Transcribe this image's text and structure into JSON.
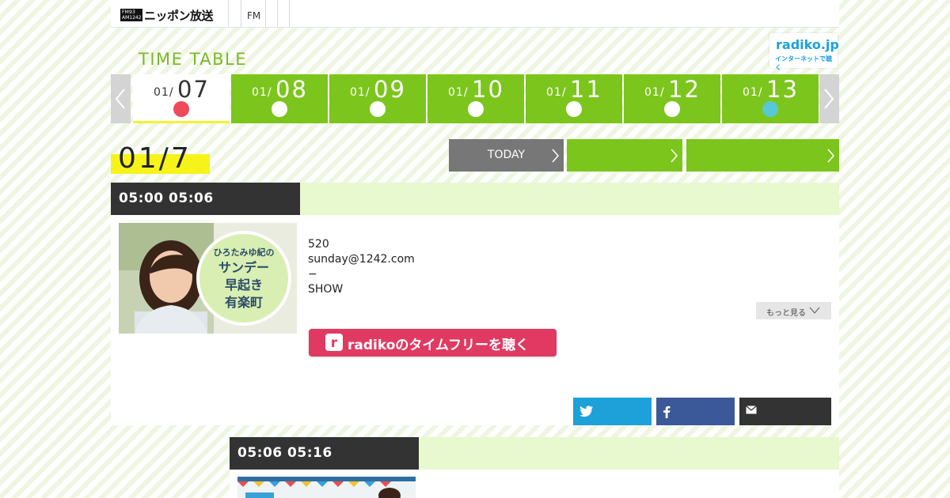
{
  "header": {
    "logo_badge_top": "FM93",
    "logo_badge_bottom": "AM1242",
    "logo_text": "ニッポン放送",
    "nav_items": [
      "FM",
      "",
      ""
    ]
  },
  "timetable": {
    "title": "TIME TABLE",
    "radiko_name": "radiko.jp",
    "radiko_tagline": "インターネットで聴く"
  },
  "dates": [
    {
      "month": "01/",
      "day": "07",
      "dot_color": "#ee4a5a",
      "active": true
    },
    {
      "month": "01/",
      "day": "08",
      "dot_color": "#ffffff",
      "active": false
    },
    {
      "month": "01/",
      "day": "09",
      "dot_color": "#ffffff",
      "active": false
    },
    {
      "month": "01/",
      "day": "10",
      "dot_color": "#ffffff",
      "active": false
    },
    {
      "month": "01/",
      "day": "11",
      "dot_color": "#ffffff",
      "active": false
    },
    {
      "month": "01/",
      "day": "12",
      "dot_color": "#ffffff",
      "active": false
    },
    {
      "month": "01/",
      "day": "13",
      "dot_color": "#56c9d4",
      "active": false
    }
  ],
  "current_date": "01/7",
  "actions": {
    "today_label": "TODAY",
    "btn2_label": "",
    "btn3_label": ""
  },
  "programs": [
    {
      "time": "05:00  05:06",
      "image_text_1": "ひろたみゆ紀の",
      "image_text_2": "サンデー",
      "image_text_3": "早起き",
      "image_text_4": "有楽町",
      "info_lines": [
        "520",
        "sunday@1242.com",
        "−",
        "SHOW"
      ],
      "more_label": "もっと見る",
      "radiko_button_label": "radikoのタイムフリーを聴く"
    },
    {
      "time": "05:06  05:16"
    }
  ],
  "colors": {
    "green": "#7cc51d",
    "light_green": "#e8f8cf",
    "dark": "#333333",
    "highlight_yellow": "#f6f31b",
    "radiko_pink": "#e03a63",
    "twitter": "#1da1d8",
    "facebook": "#3b5998",
    "mail": "#333333"
  },
  "icons": {
    "share": [
      "twitter-icon",
      "facebook-icon",
      "mail-icon"
    ]
  }
}
